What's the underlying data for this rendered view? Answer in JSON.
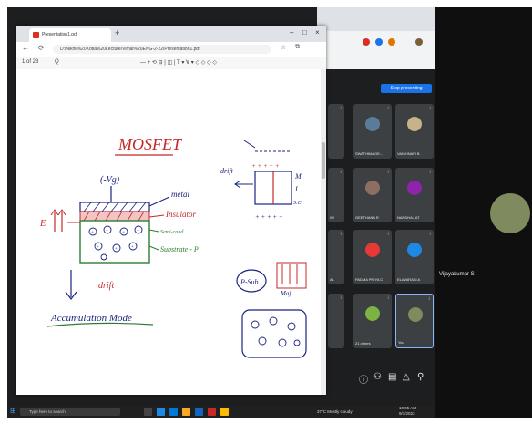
{
  "pdf_window": {
    "tab_title": "Presentation1.pdf",
    "tab_plus": "+",
    "window_controls": [
      "–",
      "□",
      "×"
    ],
    "address": "D:/Nikhil%20Kotla%20Lecture/Vimal%20ENG-2-22/Presentation1.pdf",
    "page_field": "1 of 28",
    "toolbar_left": "Q",
    "toolbar_center": "— + ⟲ ⊟ | ◫ | 𝖳 ▾ ∀ ▾ ◇ ◇ ◇ ◇"
  },
  "notes": {
    "heading": "MOSFET",
    "gate_voltage": "(-Vg)",
    "metal": "metal",
    "insulator": "Insulator",
    "semiconductor": "Semi-cond",
    "substrate": "Substrate - P",
    "field": "E",
    "drift": "drift",
    "charge": "Accumulation Mode",
    "p_substrate": "P-Sub",
    "majority": "Maj",
    "label_m": "M",
    "label_i": "I",
    "label_sc": "S.C"
  },
  "meet": {
    "stop_presenting": "Stop presenting",
    "participants": [
      {
        "name": "",
        "avatar_color": "#5f6368"
      },
      {
        "name": "",
        "avatar_color": "#5f6368"
      },
      {
        "name": "SWATHIMAGE...",
        "avatar_color": "#5b7c99"
      },
      {
        "name": "VAISHNAVI B",
        "avatar_color": "#c8b28a"
      },
      {
        "name": "IW",
        "avatar_color": "#5f6368"
      },
      {
        "name": "GEETHANA R",
        "avatar_color": "#8d6e63"
      },
      {
        "name": "NANDHAJ AT",
        "avatar_color": "#8e24aa"
      },
      {
        "name": "AL",
        "avatar_color": "#5f6368"
      },
      {
        "name": "PADMA PRIYA C",
        "avatar_color": "#e53935"
      },
      {
        "name": "ELAVARASI A",
        "avatar_color": "#1e88e5"
      },
      {
        "name": "",
        "avatar_color": "#5f6368"
      },
      {
        "name": "21 others",
        "avatar_color": "#7cb342"
      },
      {
        "name": "You",
        "avatar_color": "#7f8b5e"
      }
    ],
    "side_participant": "Vijayakumar S"
  },
  "taskbar": {
    "search_placeholder": "Type here to search",
    "weather": "37°C Mostly cloudy",
    "time": "10:05 AM",
    "date": "9/1/2023"
  }
}
